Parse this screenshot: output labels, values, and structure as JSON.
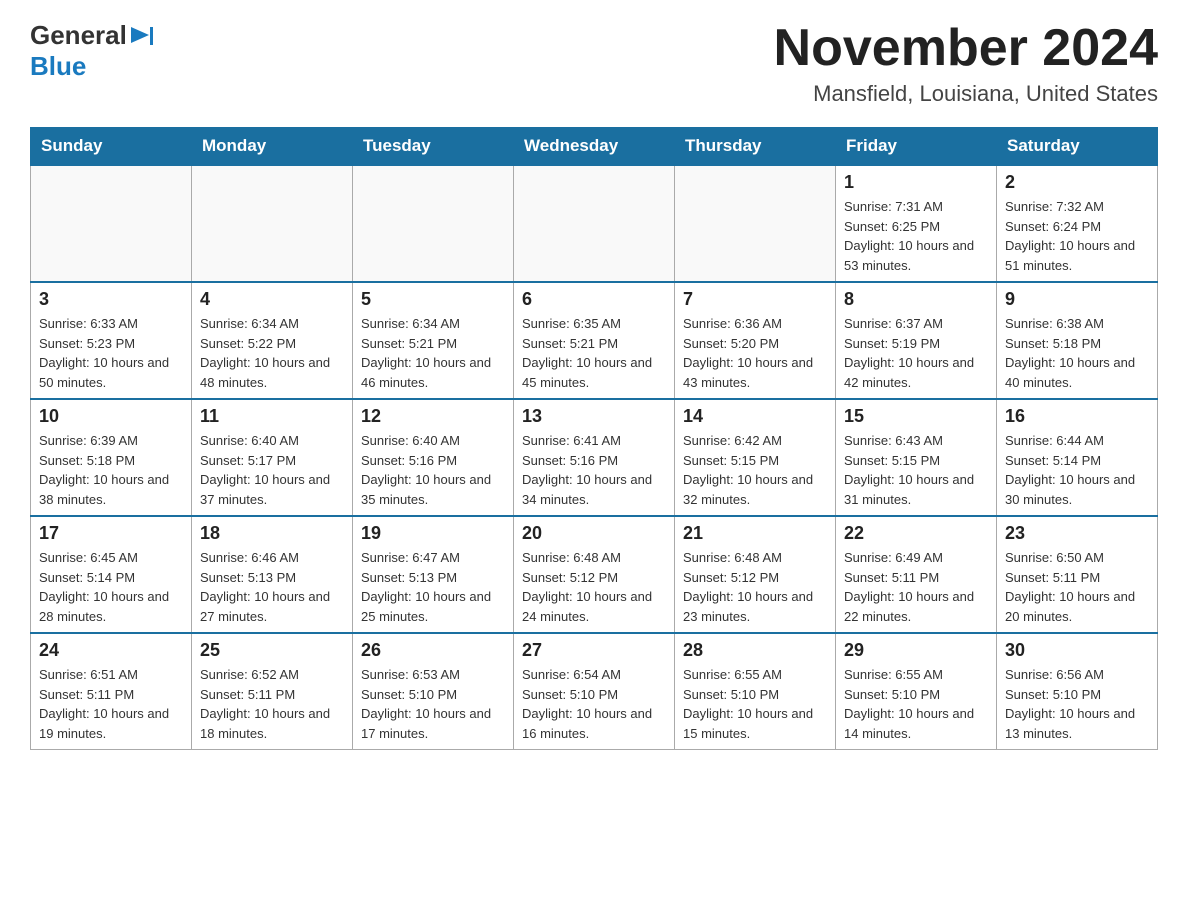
{
  "header": {
    "logo_general": "General",
    "logo_blue": "Blue",
    "month_title": "November 2024",
    "location": "Mansfield, Louisiana, United States"
  },
  "days_of_week": [
    "Sunday",
    "Monday",
    "Tuesday",
    "Wednesday",
    "Thursday",
    "Friday",
    "Saturday"
  ],
  "weeks": [
    [
      {
        "day": "",
        "sunrise": "",
        "sunset": "",
        "daylight": ""
      },
      {
        "day": "",
        "sunrise": "",
        "sunset": "",
        "daylight": ""
      },
      {
        "day": "",
        "sunrise": "",
        "sunset": "",
        "daylight": ""
      },
      {
        "day": "",
        "sunrise": "",
        "sunset": "",
        "daylight": ""
      },
      {
        "day": "",
        "sunrise": "",
        "sunset": "",
        "daylight": ""
      },
      {
        "day": "1",
        "sunrise": "Sunrise: 7:31 AM",
        "sunset": "Sunset: 6:25 PM",
        "daylight": "Daylight: 10 hours and 53 minutes."
      },
      {
        "day": "2",
        "sunrise": "Sunrise: 7:32 AM",
        "sunset": "Sunset: 6:24 PM",
        "daylight": "Daylight: 10 hours and 51 minutes."
      }
    ],
    [
      {
        "day": "3",
        "sunrise": "Sunrise: 6:33 AM",
        "sunset": "Sunset: 5:23 PM",
        "daylight": "Daylight: 10 hours and 50 minutes."
      },
      {
        "day": "4",
        "sunrise": "Sunrise: 6:34 AM",
        "sunset": "Sunset: 5:22 PM",
        "daylight": "Daylight: 10 hours and 48 minutes."
      },
      {
        "day": "5",
        "sunrise": "Sunrise: 6:34 AM",
        "sunset": "Sunset: 5:21 PM",
        "daylight": "Daylight: 10 hours and 46 minutes."
      },
      {
        "day": "6",
        "sunrise": "Sunrise: 6:35 AM",
        "sunset": "Sunset: 5:21 PM",
        "daylight": "Daylight: 10 hours and 45 minutes."
      },
      {
        "day": "7",
        "sunrise": "Sunrise: 6:36 AM",
        "sunset": "Sunset: 5:20 PM",
        "daylight": "Daylight: 10 hours and 43 minutes."
      },
      {
        "day": "8",
        "sunrise": "Sunrise: 6:37 AM",
        "sunset": "Sunset: 5:19 PM",
        "daylight": "Daylight: 10 hours and 42 minutes."
      },
      {
        "day": "9",
        "sunrise": "Sunrise: 6:38 AM",
        "sunset": "Sunset: 5:18 PM",
        "daylight": "Daylight: 10 hours and 40 minutes."
      }
    ],
    [
      {
        "day": "10",
        "sunrise": "Sunrise: 6:39 AM",
        "sunset": "Sunset: 5:18 PM",
        "daylight": "Daylight: 10 hours and 38 minutes."
      },
      {
        "day": "11",
        "sunrise": "Sunrise: 6:40 AM",
        "sunset": "Sunset: 5:17 PM",
        "daylight": "Daylight: 10 hours and 37 minutes."
      },
      {
        "day": "12",
        "sunrise": "Sunrise: 6:40 AM",
        "sunset": "Sunset: 5:16 PM",
        "daylight": "Daylight: 10 hours and 35 minutes."
      },
      {
        "day": "13",
        "sunrise": "Sunrise: 6:41 AM",
        "sunset": "Sunset: 5:16 PM",
        "daylight": "Daylight: 10 hours and 34 minutes."
      },
      {
        "day": "14",
        "sunrise": "Sunrise: 6:42 AM",
        "sunset": "Sunset: 5:15 PM",
        "daylight": "Daylight: 10 hours and 32 minutes."
      },
      {
        "day": "15",
        "sunrise": "Sunrise: 6:43 AM",
        "sunset": "Sunset: 5:15 PM",
        "daylight": "Daylight: 10 hours and 31 minutes."
      },
      {
        "day": "16",
        "sunrise": "Sunrise: 6:44 AM",
        "sunset": "Sunset: 5:14 PM",
        "daylight": "Daylight: 10 hours and 30 minutes."
      }
    ],
    [
      {
        "day": "17",
        "sunrise": "Sunrise: 6:45 AM",
        "sunset": "Sunset: 5:14 PM",
        "daylight": "Daylight: 10 hours and 28 minutes."
      },
      {
        "day": "18",
        "sunrise": "Sunrise: 6:46 AM",
        "sunset": "Sunset: 5:13 PM",
        "daylight": "Daylight: 10 hours and 27 minutes."
      },
      {
        "day": "19",
        "sunrise": "Sunrise: 6:47 AM",
        "sunset": "Sunset: 5:13 PM",
        "daylight": "Daylight: 10 hours and 25 minutes."
      },
      {
        "day": "20",
        "sunrise": "Sunrise: 6:48 AM",
        "sunset": "Sunset: 5:12 PM",
        "daylight": "Daylight: 10 hours and 24 minutes."
      },
      {
        "day": "21",
        "sunrise": "Sunrise: 6:48 AM",
        "sunset": "Sunset: 5:12 PM",
        "daylight": "Daylight: 10 hours and 23 minutes."
      },
      {
        "day": "22",
        "sunrise": "Sunrise: 6:49 AM",
        "sunset": "Sunset: 5:11 PM",
        "daylight": "Daylight: 10 hours and 22 minutes."
      },
      {
        "day": "23",
        "sunrise": "Sunrise: 6:50 AM",
        "sunset": "Sunset: 5:11 PM",
        "daylight": "Daylight: 10 hours and 20 minutes."
      }
    ],
    [
      {
        "day": "24",
        "sunrise": "Sunrise: 6:51 AM",
        "sunset": "Sunset: 5:11 PM",
        "daylight": "Daylight: 10 hours and 19 minutes."
      },
      {
        "day": "25",
        "sunrise": "Sunrise: 6:52 AM",
        "sunset": "Sunset: 5:11 PM",
        "daylight": "Daylight: 10 hours and 18 minutes."
      },
      {
        "day": "26",
        "sunrise": "Sunrise: 6:53 AM",
        "sunset": "Sunset: 5:10 PM",
        "daylight": "Daylight: 10 hours and 17 minutes."
      },
      {
        "day": "27",
        "sunrise": "Sunrise: 6:54 AM",
        "sunset": "Sunset: 5:10 PM",
        "daylight": "Daylight: 10 hours and 16 minutes."
      },
      {
        "day": "28",
        "sunrise": "Sunrise: 6:55 AM",
        "sunset": "Sunset: 5:10 PM",
        "daylight": "Daylight: 10 hours and 15 minutes."
      },
      {
        "day": "29",
        "sunrise": "Sunrise: 6:55 AM",
        "sunset": "Sunset: 5:10 PM",
        "daylight": "Daylight: 10 hours and 14 minutes."
      },
      {
        "day": "30",
        "sunrise": "Sunrise: 6:56 AM",
        "sunset": "Sunset: 5:10 PM",
        "daylight": "Daylight: 10 hours and 13 minutes."
      }
    ]
  ]
}
